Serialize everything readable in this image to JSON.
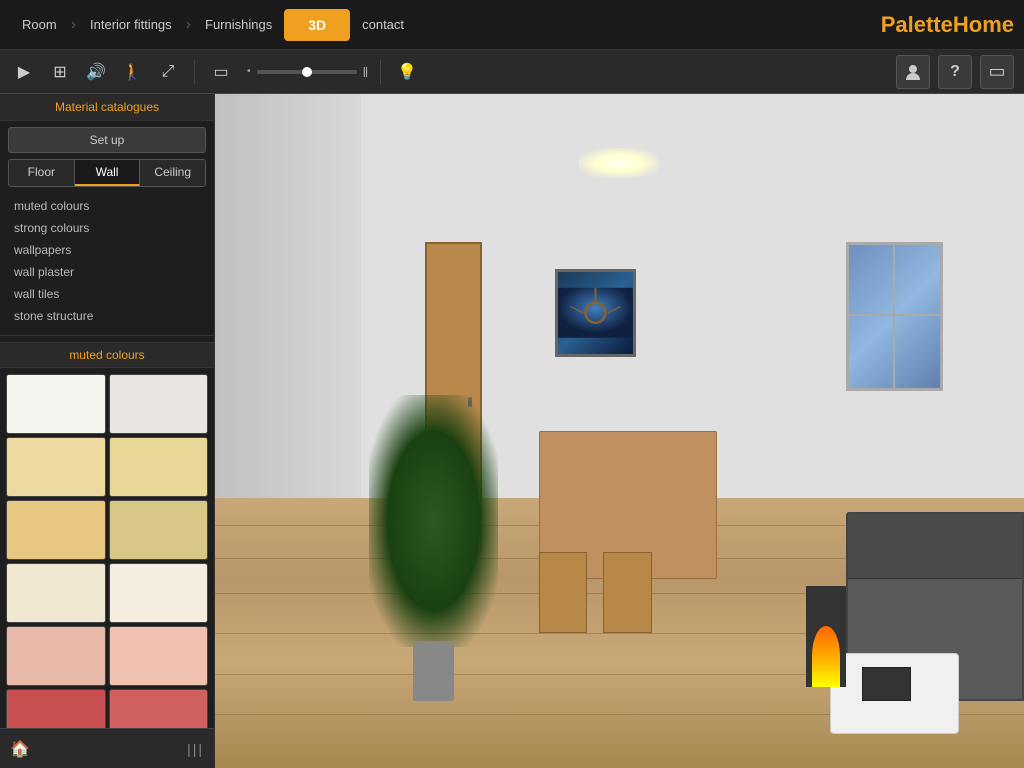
{
  "nav": {
    "items": [
      {
        "label": "Room",
        "active": false
      },
      {
        "label": "Interior fittings",
        "active": false
      },
      {
        "label": "Furnishings",
        "active": false
      },
      {
        "label": "3D",
        "active": true
      },
      {
        "label": "contact",
        "active": false
      }
    ],
    "logo_prefix": "Palette",
    "logo_suffix": "Home"
  },
  "toolbar": {
    "play_icon": "▶",
    "grid_icon": "⊞",
    "sound_icon": "🔊",
    "person_icon": "🚶",
    "move_icon": "⤢",
    "rect_icon": "▭",
    "dot_icon": "•",
    "bar_icon": "‖",
    "light_icon": "💡",
    "slider_value": "50",
    "right_icons": [
      "👤",
      "?",
      "▭"
    ]
  },
  "sidebar": {
    "section_label": "Material catalogues",
    "setup_label": "Set up",
    "tabs": [
      {
        "label": "Floor",
        "active": false
      },
      {
        "label": "Wall",
        "active": true
      },
      {
        "label": "Ceiling",
        "active": false
      }
    ],
    "material_items": [
      {
        "label": "muted colours"
      },
      {
        "label": "strong colours"
      },
      {
        "label": "wallpapers"
      },
      {
        "label": "wall plaster"
      },
      {
        "label": "wall tiles"
      },
      {
        "label": "stone structure"
      }
    ],
    "colour_section_label": "muted colours",
    "swatches": [
      {
        "color": "#f5f5f0",
        "name": "white-swatch"
      },
      {
        "color": "#e8e4e0",
        "name": "light-grey-swatch"
      },
      {
        "color": "#eddaa0",
        "name": "light-yellow-swatch"
      },
      {
        "color": "#e8d898",
        "name": "cream-swatch"
      },
      {
        "color": "#e8c880",
        "name": "warm-yellow-swatch"
      },
      {
        "color": "#d8c888",
        "name": "pale-yellow-swatch"
      },
      {
        "color": "#f0e8d0",
        "name": "off-white-swatch"
      },
      {
        "color": "#f5eee0",
        "name": "ivory-swatch"
      },
      {
        "color": "#e8b8a8",
        "name": "light-pink-swatch"
      },
      {
        "color": "#f0c0b0",
        "name": "salmon-swatch"
      },
      {
        "color": "#c85050",
        "name": "red-swatch"
      },
      {
        "color": "#d06060",
        "name": "dark-red-swatch"
      }
    ],
    "bottom_icon_left": "🏠",
    "bottom_icon_center": "|||"
  }
}
